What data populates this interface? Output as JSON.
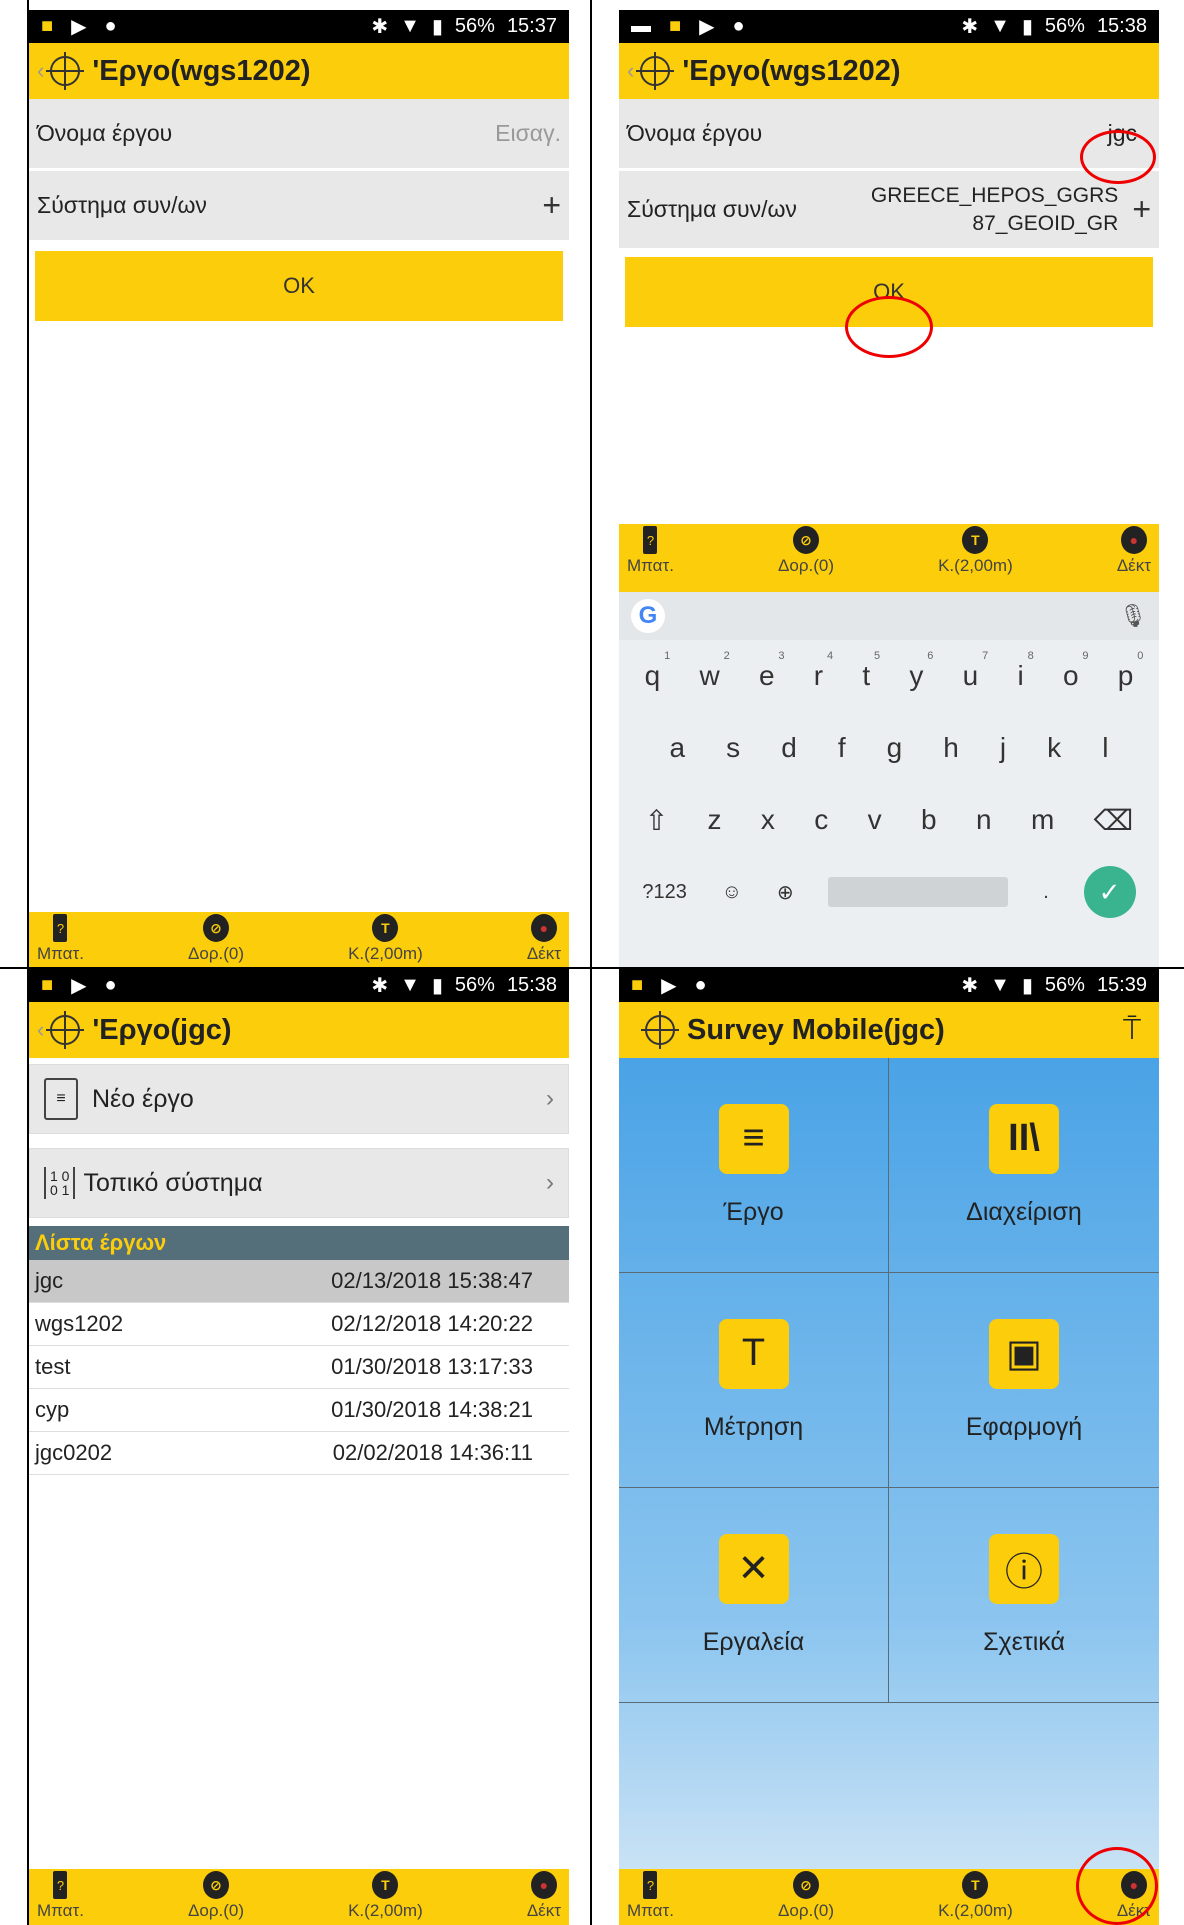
{
  "status_left": [
    "■",
    "▶",
    "●"
  ],
  "panels": [
    {
      "battery": "56%",
      "time": "15:37"
    },
    {
      "battery": "56%",
      "time": "15:38"
    },
    {
      "battery": "56%",
      "time": "15:38"
    },
    {
      "battery": "56%",
      "time": "15:39"
    }
  ],
  "p1": {
    "title": "'Εργο(wgs1202)",
    "name_label": "Όνομα έργου",
    "name_placeholder": "Εισαγ.",
    "coord_label": "Σύστημα συν/ων",
    "ok": "OK"
  },
  "p2": {
    "title": "'Εργο(wgs1202)",
    "name_label": "Όνομα έργου",
    "name_value": "jgc",
    "coord_label": "Σύστημα συν/ων",
    "coord_value_1": "GREECE_HEPOS_GGRS",
    "coord_value_2": "87_GEOID_GR",
    "ok": "OK"
  },
  "bottom": {
    "battery": "Μπατ.",
    "sat": "Δορ.(0)",
    "k": "Κ.(2,00m)",
    "rec": "Δέκτ"
  },
  "keyboard": {
    "row1": [
      "q",
      "w",
      "e",
      "r",
      "t",
      "y",
      "u",
      "i",
      "o",
      "p"
    ],
    "row1_nums": [
      "1",
      "2",
      "3",
      "4",
      "5",
      "6",
      "7",
      "8",
      "9",
      "0"
    ],
    "row2": [
      "a",
      "s",
      "d",
      "f",
      "g",
      "h",
      "j",
      "k",
      "l"
    ],
    "row3": [
      "z",
      "x",
      "c",
      "v",
      "b",
      "n",
      "m"
    ],
    "sym": "?123",
    "period": "."
  },
  "p3": {
    "title": "'Εργο(jgc)",
    "new_project": "Νέο έργο",
    "local_system": "Τοπικό σύστημα",
    "list_header": "Λίστα έργων",
    "projects": [
      {
        "name": "jgc",
        "date": "02/13/2018 15:38:47"
      },
      {
        "name": "wgs1202",
        "date": "02/12/2018 14:20:22"
      },
      {
        "name": "test",
        "date": "01/30/2018 13:17:33"
      },
      {
        "name": "cyp",
        "date": "01/30/2018 14:38:21"
      },
      {
        "name": "jgc0202",
        "date": "02/02/2018 14:36:11"
      }
    ]
  },
  "p4": {
    "title": "Survey Mobile(jgc)",
    "tiles": [
      "Έργο",
      "Διαχείριση",
      "Μέτρηση",
      "Εφαρμογή",
      "Εργαλεία",
      "Σχετικά"
    ]
  }
}
